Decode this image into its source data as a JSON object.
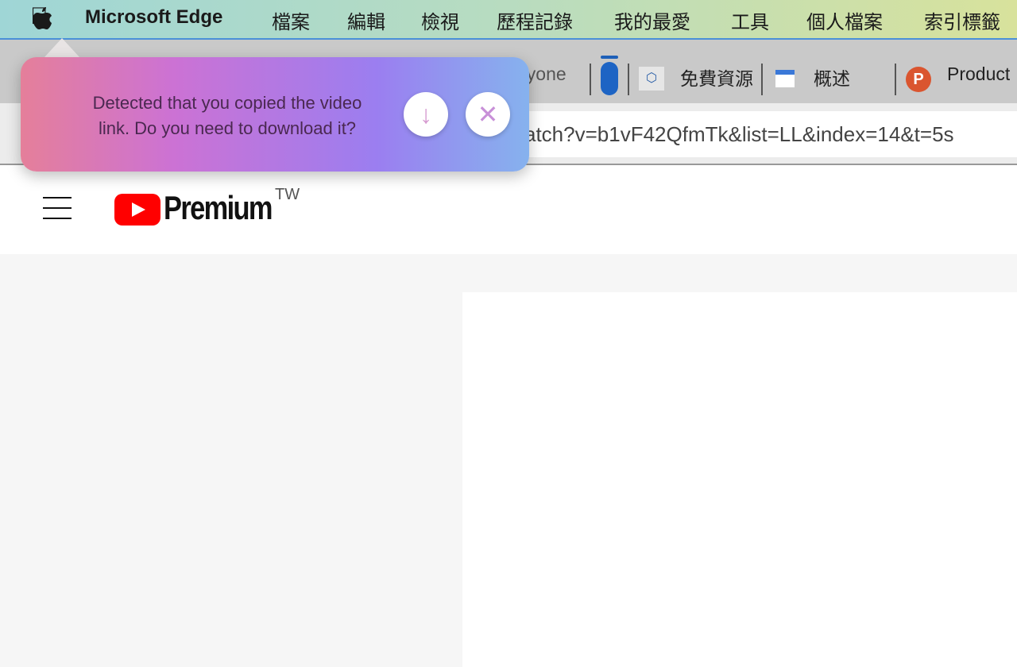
{
  "menubar": {
    "app": "Microsoft Edge",
    "items": [
      "檔案",
      "編輯",
      "檢視",
      "歷程記錄",
      "我的最愛",
      "工具",
      "個人檔案",
      "索引標籤"
    ]
  },
  "tabs": [
    {
      "label": "nyone"
    },
    {
      "label": "免費資源"
    },
    {
      "label": "概述"
    },
    {
      "label": "Product"
    }
  ],
  "address": {
    "url": "atch?v=b1vF42QfmTk&list=LL&index=14&t=5s"
  },
  "popup": {
    "message_line1": "Detected that you copied the video",
    "message_line2": "link. Do you need to download it?",
    "download_icon": "arrow-down",
    "close_icon": "x"
  },
  "youtube": {
    "logo_text": "Premium",
    "region": "TW"
  },
  "colors": {
    "youtube_red": "#ff0000",
    "producthunt": "#da552f"
  }
}
